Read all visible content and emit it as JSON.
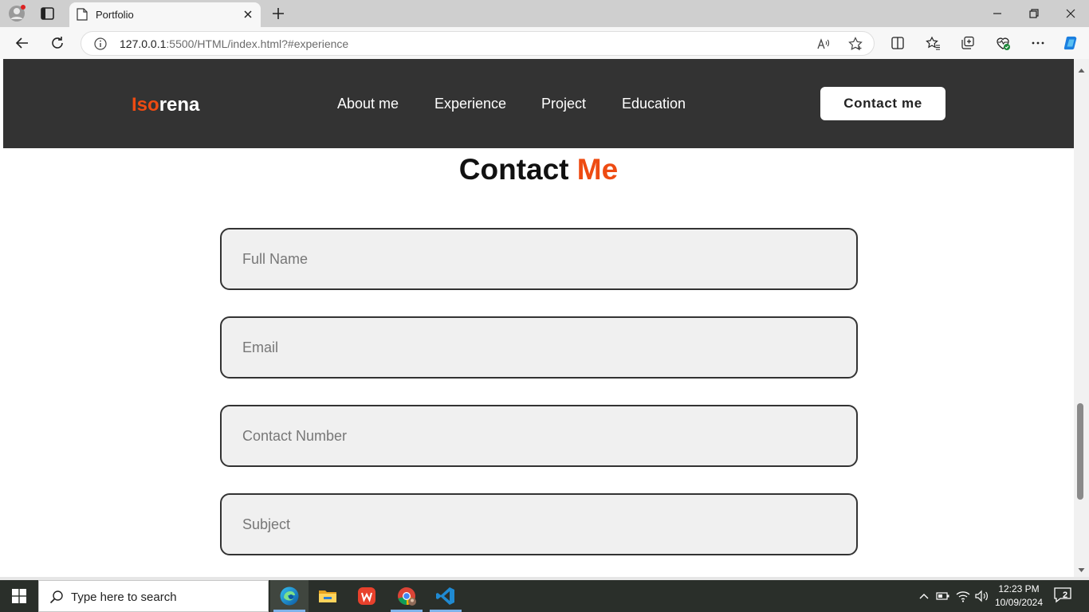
{
  "browser": {
    "tab_title": "Portfolio",
    "url_host": "127.0.0.1",
    "url_path": ":5500/HTML/index.html?#experience"
  },
  "site": {
    "logo_accent": "Iso",
    "logo_rest": "rena",
    "nav": [
      "About me",
      "Experience",
      "Project",
      "Education"
    ],
    "cta": "Contact me",
    "accent_color": "#ee4b12",
    "header_color": "#333333"
  },
  "contact": {
    "title_main": "Contact",
    "title_accent": "Me",
    "fields": [
      {
        "placeholder": "Full Name",
        "value": ""
      },
      {
        "placeholder": "Email",
        "value": ""
      },
      {
        "placeholder": "Contact Number",
        "value": ""
      },
      {
        "placeholder": "Subject",
        "value": ""
      }
    ]
  },
  "taskbar": {
    "search_placeholder": "Type here to search",
    "time": "12:23 PM",
    "date": "10/09/2024",
    "notification_count": "2",
    "apps": [
      "edge-icon",
      "file-explorer-icon",
      "wps-office-icon",
      "chrome-icon",
      "vscode-icon"
    ]
  }
}
